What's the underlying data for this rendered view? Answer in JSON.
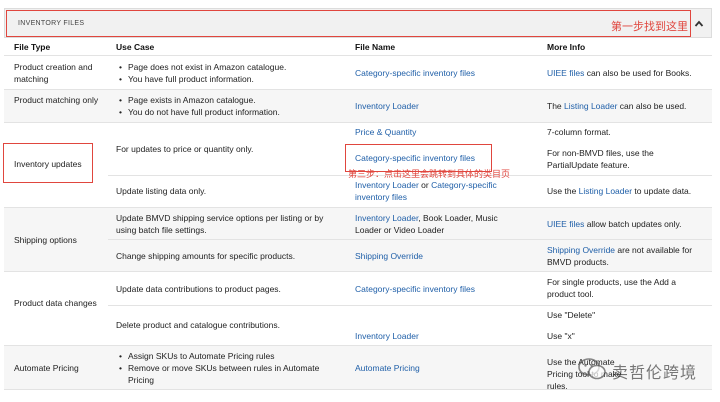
{
  "header": {
    "title": "INVENTORY FILES",
    "annotation": "第一步找到这里"
  },
  "columns": [
    "File Type",
    "Use Case",
    "File Name",
    "More Info"
  ],
  "rows": {
    "r1": {
      "type": "Product creation and matching",
      "use_case": [
        "Page does not exist in Amazon catalogue.",
        "You have full product information."
      ],
      "file": "Category-specific inventory files",
      "info_link": "UIEE files",
      "info_text": " can also be used for Books."
    },
    "r2": {
      "type": "Product matching only",
      "use_case": [
        "Page exists in Amazon catalogue.",
        "You do not have full product information."
      ],
      "file": "Inventory Loader",
      "info_pre": "The ",
      "info_link": "Listing Loader",
      "info_text": " can also be used."
    },
    "r3": {
      "type": "Inventory updates",
      "use_case_a": "For updates to price or quantity only.",
      "file_a1": "Price & Quantity",
      "info_a1": "7-column format.",
      "file_a2": "Category-specific inventory files",
      "info_a2": "For non-BMVD files, use the PartialUpdate feature.",
      "annotation": "第三步：点击这里会跳转到具体的类目页",
      "use_case_b": "Update listing data only.",
      "file_b_1": "Inventory Loader",
      "file_b_sep": " or ",
      "file_b_2": "Category-specific inventory files",
      "info_b_pre": "Use the ",
      "info_b_link": "Listing Loader",
      "info_b_text": " to update data."
    },
    "r4": {
      "type": "Shipping options",
      "use_case_a": "Update BMVD shipping service options per listing or by using batch file settings.",
      "file_a_link": "Inventory Loader",
      "file_a_text": ", Book Loader, Music Loader or Video Loader",
      "info_a_link": "UIEE files",
      "info_a_text": " allow batch updates only.",
      "use_case_b": "Change shipping amounts for specific products.",
      "file_b": "Shipping Override",
      "info_b_link": "Shipping Override",
      "info_b_text": " are not available for BMVD products."
    },
    "r5": {
      "type": "Product data changes",
      "use_case_a": "Update data contributions to product pages.",
      "file_a": "Category-specific inventory files",
      "info_a": "For single products, use the Add a product tool.",
      "use_case_b": "Delete product and catalogue contributions.",
      "info_b1": "Use \"Delete\"",
      "file_b": "Inventory Loader",
      "info_b2": "Use \"x\""
    },
    "r6": {
      "type": "Automate Pricing",
      "use_case": [
        "Assign SKUs to Automate Pricing rules",
        "Remove or move SKUs between rules in Automate Pricing"
      ],
      "file": "Automate Pricing",
      "info": "Use the Automate Pricing tool to make rules."
    }
  },
  "watermark": "卖哲伦跨境",
  "colors": {
    "link": "#1f5fa8",
    "annotation_red": "#e0463e",
    "header_bg": "#f1f1f1",
    "alt_row_bg": "#f6f6f6"
  },
  "icons": [
    "chevron-up-icon",
    "wechat-logo-icon"
  ]
}
